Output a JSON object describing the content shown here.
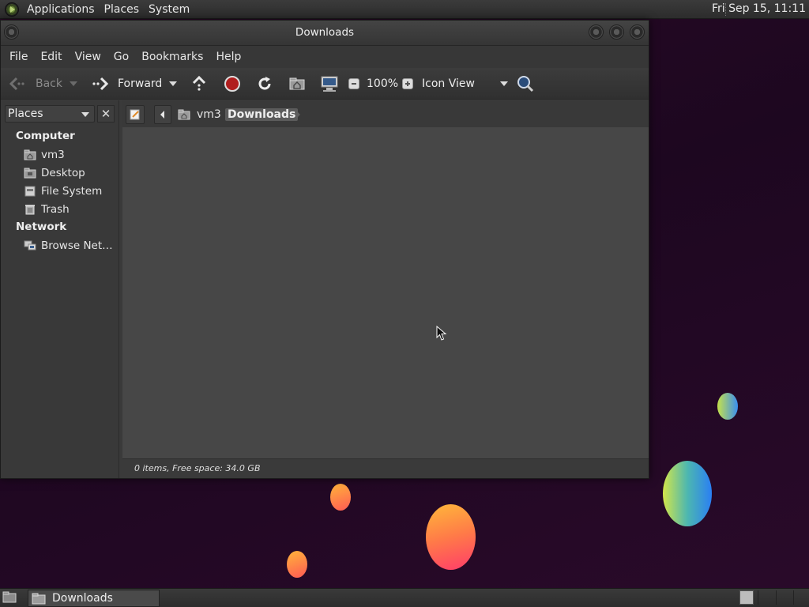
{
  "top_panel": {
    "menus": [
      "Applications",
      "Places",
      "System"
    ],
    "clock": "Fri Sep 15, 11:11"
  },
  "window": {
    "title": "Downloads",
    "menubar": [
      "File",
      "Edit",
      "View",
      "Go",
      "Bookmarks",
      "Help"
    ],
    "toolbar": {
      "back_label": "Back",
      "forward_label": "Forward",
      "zoom_level": "100%",
      "view_mode": "Icon View"
    },
    "sidepane": {
      "selector_label": "Places",
      "close_glyph": "✕",
      "computer_heading": "Computer",
      "computer_items": [
        {
          "label": "vm3",
          "icon": "home-folder-icon"
        },
        {
          "label": "Desktop",
          "icon": "desktop-folder-icon"
        },
        {
          "label": "File System",
          "icon": "drive-icon"
        },
        {
          "label": "Trash",
          "icon": "trash-icon"
        }
      ],
      "network_heading": "Network",
      "network_items": [
        {
          "label": "Browse Net…",
          "icon": "network-icon"
        }
      ]
    },
    "pathbar": {
      "segments": [
        "vm3",
        "Downloads"
      ]
    },
    "status": "0 items, Free space: 34.0 GB"
  },
  "taskbar": {
    "task_label": "Downloads"
  },
  "colors": {
    "window_bg": "#3a3a3a",
    "view_bg": "#474747",
    "desktop_bg": "#220a22"
  }
}
